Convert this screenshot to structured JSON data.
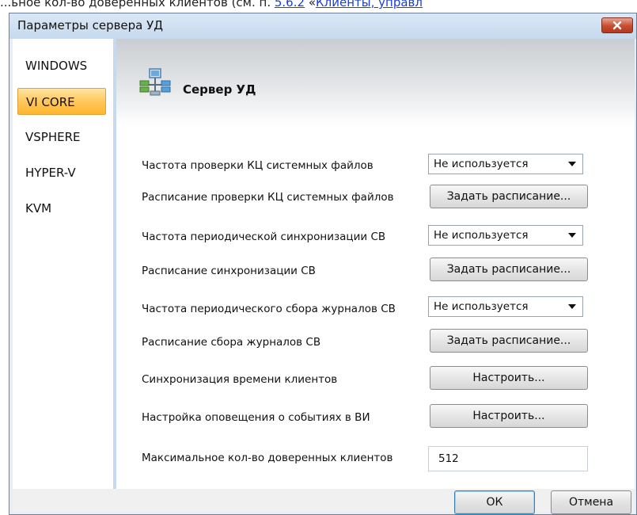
{
  "background_doc": {
    "text_before": "...ьное кол-во доверенных клиентов (см. п. ",
    "link1": "5.6.2",
    "text_middle": " «",
    "link2": "Клиенты, управл"
  },
  "window": {
    "title": "Параметры сервера УД",
    "close_icon": "close-icon"
  },
  "sidebar": {
    "items": [
      {
        "label": "WINDOWS",
        "active": false
      },
      {
        "label": "VI CORE",
        "active": true
      },
      {
        "label": "VSPHERE",
        "active": false
      },
      {
        "label": "HYPER-V",
        "active": false
      },
      {
        "label": "KVM",
        "active": false
      }
    ]
  },
  "section": {
    "title": "Сервер УД",
    "icon": "server-network-icon"
  },
  "settings": {
    "kc_frequency_label": "Частота проверки КЦ системных файлов",
    "kc_frequency_value": "Не используется",
    "kc_schedule_label": "Расписание проверки КЦ системных файлов",
    "kc_schedule_button": "Задать расписание...",
    "sync_frequency_label": "Частота периодической синхронизации СВ",
    "sync_frequency_value": "Не используется",
    "sync_schedule_label": "Расписание синхронизации СВ",
    "sync_schedule_button": "Задать расписание...",
    "log_frequency_label": "Частота периодического сбора журналов СВ",
    "log_frequency_value": "Не используется",
    "log_schedule_label": "Расписание сбора журналов СВ",
    "log_schedule_button": "Задать расписание...",
    "time_sync_label": "Синхронизация времени клиентов",
    "time_sync_button": "Настроить...",
    "notify_label": "Настройка оповещения о событиях в ВИ",
    "notify_button": "Настроить...",
    "max_clients_label": "Максимальное кол-во доверенных клиентов",
    "max_clients_value": "512"
  },
  "footer": {
    "ok_label": "ОК",
    "cancel_label": "Отмена"
  },
  "colors": {
    "active_item": "#ffc85c",
    "titlebar": "#c6d9ee",
    "close_button": "#c74b2f",
    "link": "#1a3fd6"
  }
}
